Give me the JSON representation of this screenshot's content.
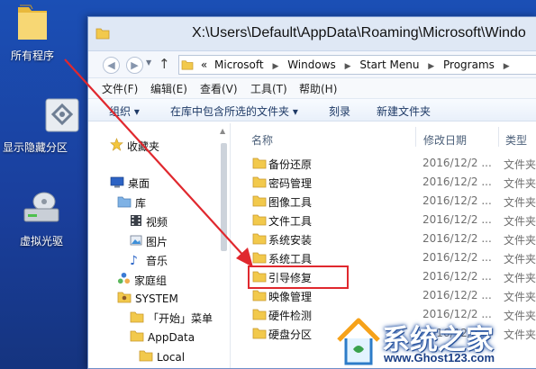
{
  "desktop": {
    "icons": [
      {
        "label": "所有程序"
      },
      {
        "label": "显示隐藏分区"
      },
      {
        "label": "虚拟光驱"
      }
    ]
  },
  "window": {
    "title": "X:\\Users\\Default\\AppData\\Roaming\\Microsoft\\Windo",
    "address": {
      "prefix": "«",
      "crumbs": [
        "Microsoft",
        "Windows",
        "Start Menu",
        "Programs"
      ]
    },
    "menu": [
      "文件(F)",
      "编辑(E)",
      "查看(V)",
      "工具(T)",
      "帮助(H)"
    ],
    "toolbar": [
      "组织 ▾",
      "在库中包含所选的文件夹 ▾",
      "刻录",
      "新建文件夹"
    ],
    "nav_pane": [
      {
        "label": "收藏夹",
        "icon": "star-icon"
      },
      {
        "label": "桌面",
        "icon": "desktop-icon"
      },
      {
        "label": "库",
        "icon": "library-icon"
      },
      {
        "label": "视频",
        "icon": "video-icon"
      },
      {
        "label": "图片",
        "icon": "picture-icon"
      },
      {
        "label": "音乐",
        "icon": "music-icon"
      },
      {
        "label": "家庭组",
        "icon": "homegroup-icon"
      },
      {
        "label": "SYSTEM",
        "icon": "user-icon"
      },
      {
        "label": "「开始」菜单",
        "icon": "folder-icon"
      },
      {
        "label": "AppData",
        "icon": "folder-icon"
      },
      {
        "label": "Local",
        "icon": "folder-icon"
      }
    ],
    "columns": {
      "name": "名称",
      "date": "修改日期",
      "type": "类型"
    },
    "files": [
      {
        "name": "备份还原",
        "date": "2016/12/2 ...",
        "type": "文件夹"
      },
      {
        "name": "密码管理",
        "date": "2016/12/2 ...",
        "type": "文件夹"
      },
      {
        "name": "图像工具",
        "date": "2016/12/2 ...",
        "type": "文件夹"
      },
      {
        "name": "文件工具",
        "date": "2016/12/2 ...",
        "type": "文件夹"
      },
      {
        "name": "系统安装",
        "date": "2016/12/2 ...",
        "type": "文件夹"
      },
      {
        "name": "系统工具",
        "date": "2016/12/2 ...",
        "type": "文件夹"
      },
      {
        "name": "引导修复",
        "date": "2016/12/2 ...",
        "type": "文件夹"
      },
      {
        "name": "映像管理",
        "date": "2016/12/2 ...",
        "type": "文件夹"
      },
      {
        "name": "硬件检测",
        "date": "2016/12/2 ...",
        "type": "文件夹"
      },
      {
        "name": "硬盘分区",
        "date": "2016/12/2 ...",
        "type": "文件夹"
      }
    ]
  },
  "watermark": {
    "title": "系统之家",
    "url": "www.Ghost123.com"
  },
  "colors": {
    "desktop": "#1a44a6",
    "annotation": "#e0282e",
    "folder": "#f2c94c"
  }
}
